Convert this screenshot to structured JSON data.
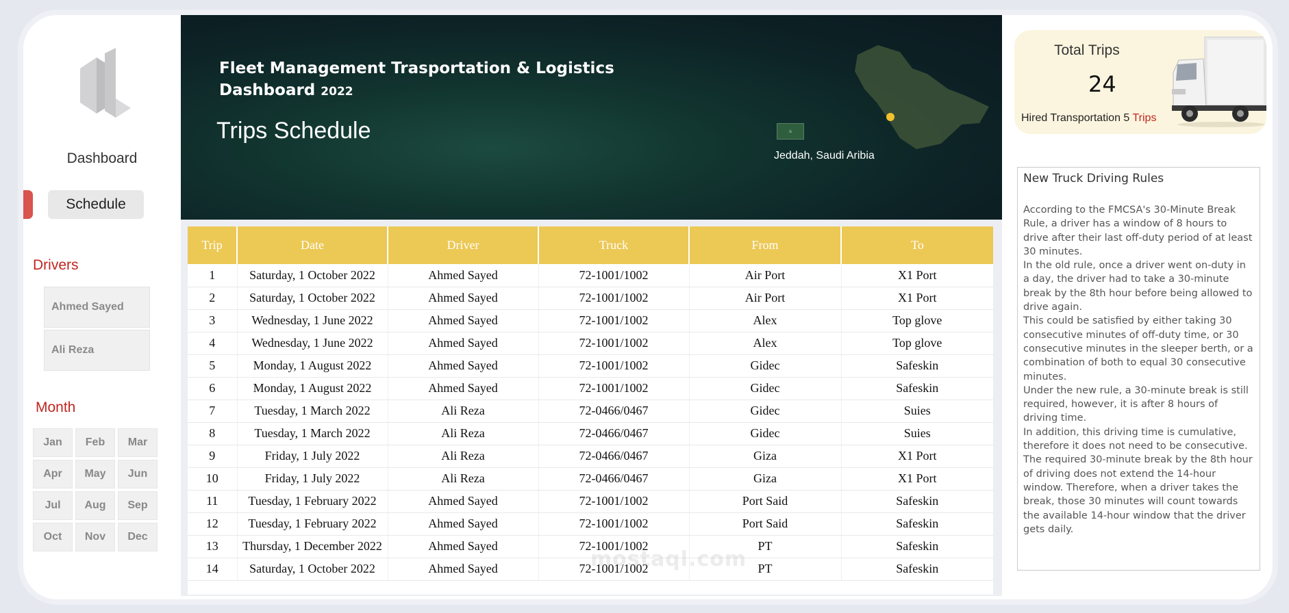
{
  "sidebar": {
    "nav_dashboard": "Dashboard",
    "nav_schedule": "Schedule",
    "drivers_title": "Drivers",
    "drivers": [
      "Ahmed Sayed",
      "Ali Reza"
    ],
    "month_title": "Month",
    "months": [
      "Jan",
      "Feb",
      "Mar",
      "Apr",
      "May",
      "Jun",
      "Jul",
      "Aug",
      "Sep",
      "Oct",
      "Nov",
      "Dec"
    ]
  },
  "header": {
    "title": "Fleet Management Trasportation & Logistics",
    "title_line2": "Dashboard",
    "year": "2022",
    "subtitle": "Trips Schedule",
    "location": "Jeddah, Saudi Aribia"
  },
  "table": {
    "columns": [
      "Trip",
      "Date",
      "Driver",
      "Truck",
      "From",
      "To"
    ],
    "rows": [
      [
        "1",
        "Saturday, 1 October 2022",
        "Ahmed Sayed",
        "72-1001/1002",
        "Air Port",
        "X1 Port"
      ],
      [
        "2",
        "Saturday, 1 October 2022",
        "Ahmed Sayed",
        "72-1001/1002",
        "Air Port",
        "X1 Port"
      ],
      [
        "3",
        "Wednesday, 1 June 2022",
        "Ahmed Sayed",
        "72-1001/1002",
        "Alex",
        "Top glove"
      ],
      [
        "4",
        "Wednesday, 1 June 2022",
        "Ahmed Sayed",
        "72-1001/1002",
        "Alex",
        "Top glove"
      ],
      [
        "5",
        "Monday, 1 August 2022",
        "Ahmed Sayed",
        "72-1001/1002",
        "Gidec",
        "Safeskin"
      ],
      [
        "6",
        "Monday, 1 August 2022",
        "Ahmed Sayed",
        "72-1001/1002",
        "Gidec",
        "Safeskin"
      ],
      [
        "7",
        "Tuesday, 1 March 2022",
        "Ali Reza",
        "72-0466/0467",
        "Gidec",
        "Suies"
      ],
      [
        "8",
        "Tuesday, 1 March 2022",
        "Ali Reza",
        "72-0466/0467",
        "Gidec",
        "Suies"
      ],
      [
        "9",
        "Friday, 1 July 2022",
        "Ali Reza",
        "72-0466/0467",
        "Giza",
        "X1 Port"
      ],
      [
        "10",
        "Friday, 1 July 2022",
        "Ali Reza",
        "72-0466/0467",
        "Giza",
        "X1 Port"
      ],
      [
        "11",
        "Tuesday, 1 February 2022",
        "Ahmed Sayed",
        "72-1001/1002",
        "Port Said",
        "Safeskin"
      ],
      [
        "12",
        "Tuesday, 1 February 2022",
        "Ahmed Sayed",
        "72-1001/1002",
        "Port Said",
        "Safeskin"
      ],
      [
        "13",
        "Thursday, 1 December 2022",
        "Ahmed Sayed",
        "72-1001/1002",
        "PT",
        "Safeskin"
      ],
      [
        "14",
        "Saturday, 1 October 2022",
        "Ahmed Sayed",
        "72-1001/1002",
        "PT",
        "Safeskin"
      ]
    ]
  },
  "summary": {
    "total_label": "Total Trips",
    "total_value": "24",
    "hired_label": "Hired Transportation",
    "hired_value": "5",
    "hired_unit": "Trips"
  },
  "rules": {
    "title": "New Truck Driving Rules",
    "body": "According to the FMCSA's 30-Minute Break Rule, a driver has a window of 8 hours to drive after their last off-duty period of at least 30 minutes.\nIn the old rule, once a driver went on-duty in a day, the driver had to take a 30-minute break by the 8th hour before being allowed to drive again.\nThis could be satisfied by either taking 30 consecutive minutes of off-duty time, or 30 consecutive minutes in the sleeper berth, or a combination of both to equal 30 consecutive minutes.\nUnder the new rule, a 30-minute break is still required, however, it is after 8 hours of driving time.\nIn addition, this driving time is cumulative, therefore it does not need to be consecutive.\nThe required 30-minute break by the 8th hour of driving does not extend the 14-hour window. Therefore, when a driver takes the break, those 30 minutes will count towards the available 14-hour window that the driver gets daily."
  },
  "watermark": "mostaql.com",
  "colors": {
    "accent_red": "#c0261f",
    "header_gold": "#ecc855",
    "banner_dark": "#0d2326"
  }
}
